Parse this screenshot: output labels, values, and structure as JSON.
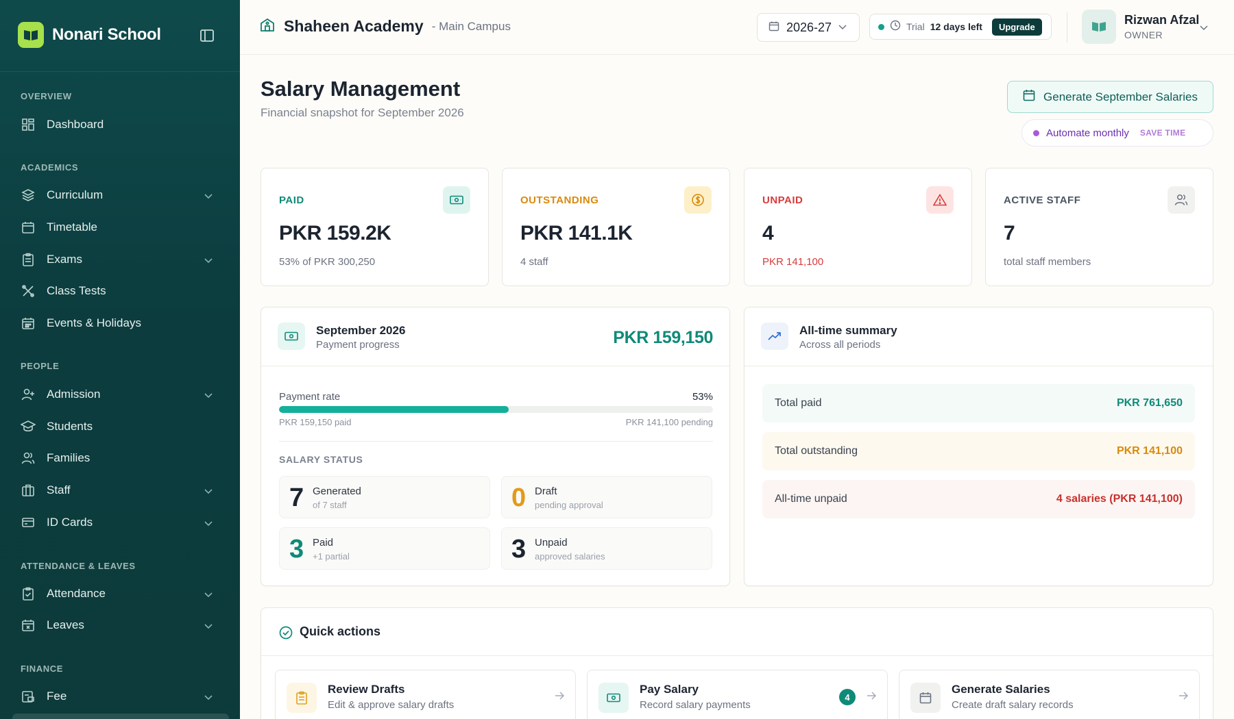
{
  "brand": {
    "name": "Nonari School"
  },
  "sidebar": {
    "sections": [
      {
        "title": "OVERVIEW"
      },
      {
        "title": "ACADEMICS"
      },
      {
        "title": "PEOPLE"
      },
      {
        "title": "ATTENDANCE & LEAVES"
      },
      {
        "title": "FINANCE"
      }
    ],
    "items": [
      {
        "label": "Dashboard",
        "icon": "grid-icon",
        "has_children": false
      },
      {
        "label": "Curriculum",
        "icon": "layers-icon",
        "has_children": true
      },
      {
        "label": "Timetable",
        "icon": "calendar-icon",
        "has_children": false
      },
      {
        "label": "Exams",
        "icon": "clipboard-icon",
        "has_children": true
      },
      {
        "label": "Class Tests",
        "icon": "tools-icon",
        "has_children": false
      },
      {
        "label": "Events & Holidays",
        "icon": "calendar-grid-icon",
        "has_children": false
      },
      {
        "label": "Admission",
        "icon": "user-plus-icon",
        "has_children": true
      },
      {
        "label": "Students",
        "icon": "graduation-cap-icon",
        "has_children": false
      },
      {
        "label": "Families",
        "icon": "users-icon",
        "has_children": false
      },
      {
        "label": "Staff",
        "icon": "briefcase-icon",
        "has_children": true
      },
      {
        "label": "ID Cards",
        "icon": "id-card-icon",
        "has_children": true
      },
      {
        "label": "Attendance",
        "icon": "clipboard-check-icon",
        "has_children": true
      },
      {
        "label": "Leaves",
        "icon": "calendar-x-icon",
        "has_children": true
      },
      {
        "label": "Fee",
        "icon": "receipt-icon",
        "has_children": true
      }
    ]
  },
  "topbar": {
    "school_name": "Shaheen Academy",
    "campus": "- Main Campus",
    "academic_year": "2026-27",
    "trial_label": "Trial",
    "trial_days": "12 days left",
    "upgrade_label": "Upgrade",
    "user_name": "Rizwan Afzal",
    "user_role": "OWNER"
  },
  "page": {
    "title": "Salary Management",
    "subtitle": "Financial snapshot for September 2026",
    "generate_button": "Generate September Salaries",
    "automate_label": "Automate monthly",
    "automate_badge": "SAVE TIME"
  },
  "stats": [
    {
      "label": "PAID",
      "value": "PKR 159.2K",
      "note": "53% of PKR 300,250",
      "color": "#0f8a78",
      "icon": "banknote-icon"
    },
    {
      "label": "OUTSTANDING",
      "value": "PKR 141.1K",
      "note": "4 staff",
      "color": "#d98a0b",
      "icon": "dollar-circle-icon"
    },
    {
      "label": "UNPAID",
      "value": "4",
      "note": "PKR 141,100",
      "color": "#d63b3b",
      "icon": "alert-triangle-icon"
    },
    {
      "label": "ACTIVE STAFF",
      "value": "7",
      "note": "total staff members",
      "color": "#4b5563",
      "icon": "users-icon"
    }
  ],
  "progress_panel": {
    "title": "September 2026",
    "subtitle": "Payment progress",
    "amount": "PKR 159,150",
    "rate_label": "Payment rate",
    "rate_value": "53%",
    "rate_fraction": 0.53,
    "paid_text": "PKR 159,150 paid",
    "pending_text": "PKR 141,100 pending",
    "status_title": "SALARY STATUS",
    "tiles": [
      {
        "num": "7",
        "title": "Generated",
        "sub": "of 7 staff",
        "color": "#1c2430"
      },
      {
        "num": "0",
        "title": "Draft",
        "sub": "pending approval",
        "color": "#e39a1a"
      },
      {
        "num": "3",
        "title": "Paid",
        "sub": "+1 partial",
        "color": "#0f8a78"
      },
      {
        "num": "3",
        "title": "Unpaid",
        "sub": "approved salaries",
        "color": "#1c2430"
      }
    ]
  },
  "summary_panel": {
    "title": "All-time summary",
    "subtitle": "Across all periods",
    "rows": [
      {
        "label": "Total paid",
        "value": "PKR 761,650",
        "color": "#0f8a78",
        "bg": "#f3faf8"
      },
      {
        "label": "Total outstanding",
        "value": "PKR 141,100",
        "color": "#d98a0b",
        "bg": "#fdf9ef"
      },
      {
        "label": "All-time unpaid",
        "value": "4 salaries (PKR 141,100)",
        "color": "#c9302c",
        "bg": "#fcf5f3"
      }
    ]
  },
  "quick_actions": {
    "title": "Quick actions",
    "cards": [
      {
        "title": "Review Drafts",
        "sub": "Edit & approve salary drafts",
        "icon": "clipboard-icon"
      },
      {
        "title": "Pay Salary",
        "sub": "Record salary payments",
        "count": "4",
        "icon": "banknote-icon"
      },
      {
        "title": "Generate Salaries",
        "sub": "Create draft salary records",
        "icon": "calendar-icon"
      }
    ]
  }
}
